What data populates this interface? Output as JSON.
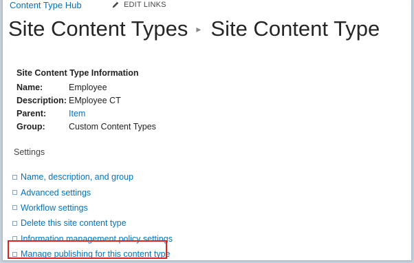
{
  "top_nav": {
    "hub_link": "Content Type Hub",
    "edit_links": "EDIT LINKS"
  },
  "title": {
    "part1": "Site Content Types",
    "separator": "▸",
    "part2": "Site Content Type"
  },
  "info": {
    "heading": "Site Content Type Information",
    "rows": [
      {
        "label": "Name:",
        "value": "Employee"
      },
      {
        "label": "Description:",
        "value": "EMployee CT"
      },
      {
        "label": "Parent:",
        "value": "Item"
      },
      {
        "label": "Group:",
        "value": "Custom Content Types"
      }
    ]
  },
  "settings": {
    "heading": "Settings",
    "links": [
      "Name, description, and group",
      "Advanced settings",
      "Workflow settings",
      "Delete this site content type",
      "Information management policy settings",
      "Manage publishing for this content type"
    ]
  },
  "colors": {
    "link": "#0072c6",
    "highlight": "#e1201e"
  }
}
